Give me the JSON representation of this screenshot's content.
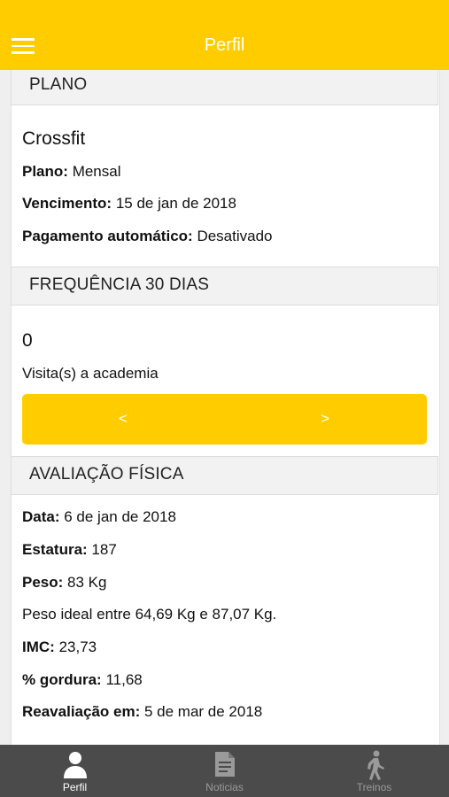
{
  "header": {
    "title": "Perfil"
  },
  "plano": {
    "section_title": "PLANO",
    "name": "Crossfit",
    "plano_label": "Plano:",
    "plano_value": "Mensal",
    "vencimento_label": "Vencimento:",
    "vencimento_value": "15 de jan de 2018",
    "pagamento_label": "Pagamento automático:",
    "pagamento_value": "Desativado"
  },
  "frequencia": {
    "section_title": "FREQUÊNCIA 30 DIAS",
    "count": "0",
    "description": "Visita(s) a academia",
    "prev_label": "<",
    "next_label": ">"
  },
  "avaliacao": {
    "section_title": "AVALIAÇÃO FÍSICA",
    "data_label": "Data:",
    "data_value": "6 de jan de 2018",
    "estatura_label": "Estatura:",
    "estatura_value": "187",
    "peso_label": "Peso:",
    "peso_value": "83 Kg",
    "peso_ideal": "Peso ideal entre 64,69 Kg e 87,07 Kg.",
    "imc_label": "IMC:",
    "imc_value": "23,73",
    "gordura_label": "% gordura:",
    "gordura_value": "11,68",
    "reavaliacao_label": "Reavaliação em:",
    "reavaliacao_value": "5 de mar de 2018"
  },
  "tabbar": {
    "tabs": [
      {
        "label": "Perfil",
        "icon": "person-icon",
        "active": true
      },
      {
        "label": "Noticias",
        "icon": "document-icon",
        "active": false
      },
      {
        "label": "Treinos",
        "icon": "walking-icon",
        "active": false
      }
    ]
  },
  "colors": {
    "accent": "#ffcc00",
    "tabbar_bg": "#4b4b4b"
  }
}
